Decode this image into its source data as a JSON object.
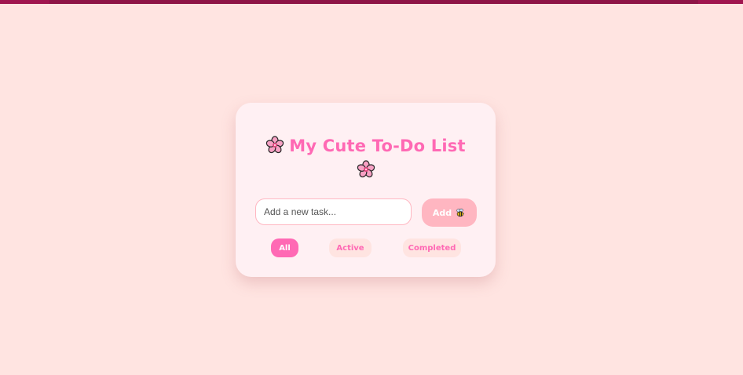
{
  "app": {
    "title": "My Cute To-Do List",
    "title_icon": "cherry-blossom-icon"
  },
  "input": {
    "placeholder": "Add a new task...",
    "value": ""
  },
  "add_button": {
    "label": "Add",
    "icon": "bee-icon"
  },
  "filters": [
    {
      "label": "All",
      "selected": true
    },
    {
      "label": "Active",
      "selected": false
    },
    {
      "label": "Completed",
      "selected": false
    }
  ],
  "colors": {
    "background": "#ffe4e1",
    "card": "#fff0f3",
    "accent": "#ff69b4",
    "button": "#ffb6c1",
    "topbar": "#a0154f"
  }
}
